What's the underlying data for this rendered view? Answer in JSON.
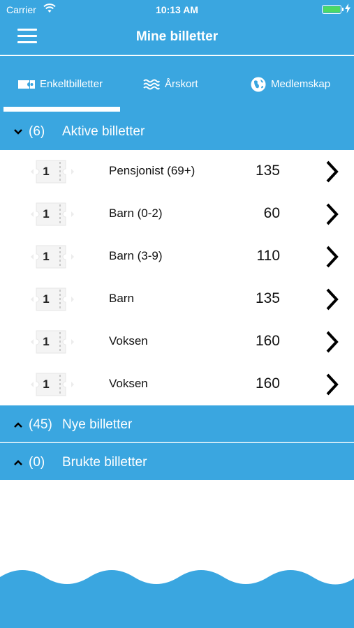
{
  "status_bar": {
    "carrier": "Carrier",
    "time": "10:13 AM"
  },
  "nav": {
    "title": "Mine billetter"
  },
  "tabs": [
    {
      "label": "Enkeltbilletter",
      "icon": "ticket-icon",
      "active": true
    },
    {
      "label": "Årskort",
      "icon": "waves-icon",
      "active": false
    },
    {
      "label": "Medlemskap",
      "icon": "globe-icon",
      "active": false
    }
  ],
  "sections": {
    "active": {
      "count": "(6)",
      "label": "Aktive billetter",
      "expanded": true
    },
    "new": {
      "count": "(45)",
      "label": "Nye billetter",
      "expanded": false
    },
    "used": {
      "count": "(0)",
      "label": "Brukte billetter",
      "expanded": false
    }
  },
  "tickets": [
    {
      "qty": "1",
      "name": "Pensjonist (69+)",
      "price": "135"
    },
    {
      "qty": "1",
      "name": "Barn (0-2)",
      "price": "60"
    },
    {
      "qty": "1",
      "name": "Barn (3-9)",
      "price": "110"
    },
    {
      "qty": "1",
      "name": "Barn",
      "price": "135"
    },
    {
      "qty": "1",
      "name": "Voksen",
      "price": "160"
    },
    {
      "qty": "1",
      "name": "Voksen",
      "price": "160"
    }
  ],
  "colors": {
    "primary": "#3aa6e0",
    "battery": "#4cd964",
    "background": "#ffffff"
  }
}
